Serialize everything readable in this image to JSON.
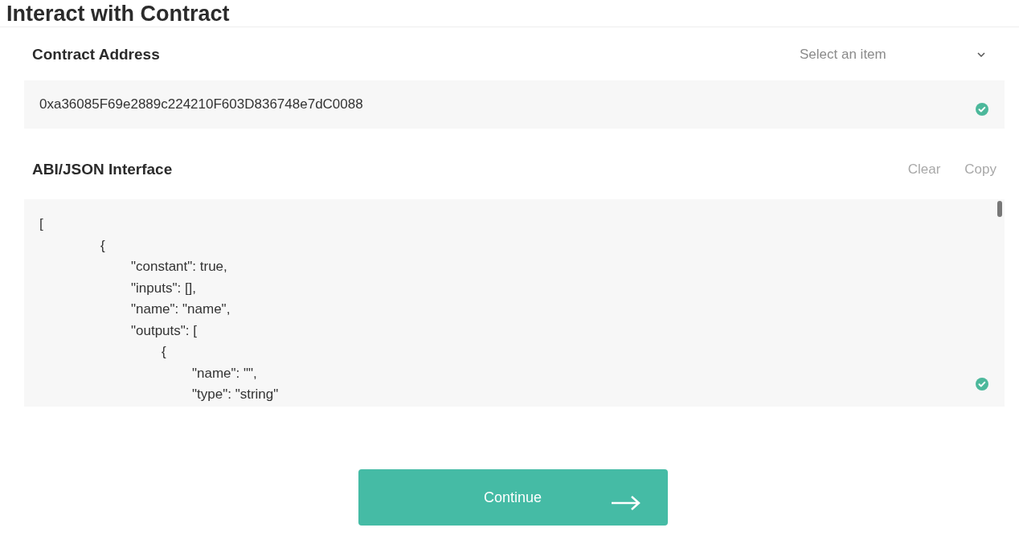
{
  "title": "Interact with Contract",
  "contract_address": {
    "label": "Contract Address",
    "select": {
      "placeholder": "Select an item"
    },
    "value": "0xa36085F69e2889c224210F603D836748e7dC0088",
    "valid": true
  },
  "abi": {
    "label": "ABI/JSON Interface",
    "actions": [
      "Clear",
      "Copy"
    ],
    "valid": true,
    "lines": [
      {
        "text": "[",
        "children": [
          {
            "text": "{",
            "children": [
              {
                "text": "\"constant\": true,"
              },
              {
                "text": "\"inputs\": [],"
              },
              {
                "text": "\"name\": \"name\","
              },
              {
                "text": "\"outputs\": [",
                "children": [
                  {
                    "text": "{",
                    "children": [
                      {
                        "text": "\"name\": \"\","
                      },
                      {
                        "text": "\"type\": \"string\""
                      }
                    ]
                  }
                ]
              }
            ]
          }
        ]
      }
    ]
  },
  "continue_button": {
    "label": "Continue"
  }
}
